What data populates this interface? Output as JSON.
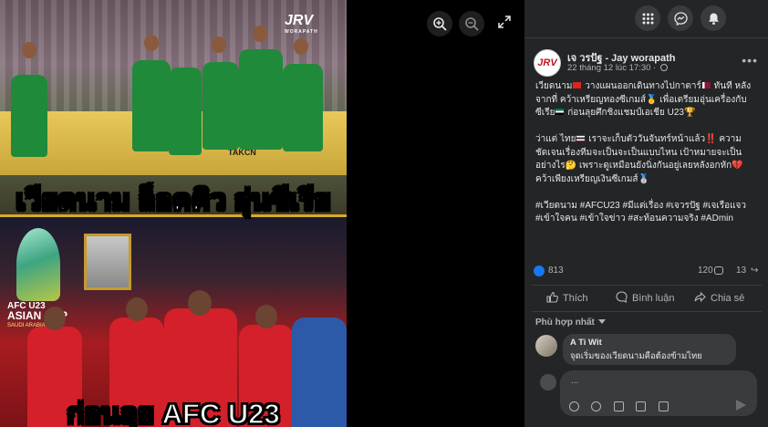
{
  "viewer": {
    "zoom_in_icon": "zoom-in-icon",
    "zoom_out_icon": "zoom-out-icon",
    "expand_icon": "expand-icon",
    "watermark": "JRV",
    "watermark_sub": "WORAPATH",
    "caption_top": "เวียดนาม ล็อคคิว อุ่นซีเรีย",
    "caption_bottom": "ก่อนลุย AFC U23",
    "cup_line1": "AFC U23",
    "cup_line2": "ASIAN CUP",
    "cup_line3": "SAUDI ARABIA 2026",
    "board_text": "TAKCN"
  },
  "topbar": {
    "menu_icon": "grid-menu-icon",
    "messenger_icon": "messenger-icon",
    "notifications_icon": "bell-icon"
  },
  "post": {
    "avatar_text": "JRV",
    "author": "เจ วรปัฐ - Jay worapath",
    "timestamp": "22 tháng 12 lúc 17:30",
    "more_label": "•••",
    "para1_a": "เวียดนาม",
    "para1_b": " วางแผนออกเดินทางไปกาตาร์",
    "para1_c": " ทันที หลังจากที่ คว้าเหรียญทองซีเกมส์🥇 เพื่อเตรียมอุ่นเครื่องกับ ซีเรีย",
    "para1_d": " ก่อนลุยศึกชิงแชมป์เอเชีย U23🏆",
    "para2_a": "ว่าแต่ ไทย",
    "para2_b": " เราจะเก็บตัววันจันทร์หน้าแล้ว‼️ ความชัดเจนเรื่องทีมจะเป็นจะเป็นแบบไหน เป้าหมายจะเป็นอย่างไร🤔 เพราะดูเหมือนยังนิ่งกันอยู่เลยหลังอกหัก💔คว้าเพียงเหรียญเงินซีเกมส์🥈",
    "para3": "#เวียดนาม #AFCU23 #มีแต่เรื่อง #เจวรปัฐ #เจเรือแจว #เข้าใจคน #เข้าใจข่าว #สะท้อนความจริง #ADmin",
    "reaction_count": "813",
    "comment_count": "120",
    "share_count": "13"
  },
  "actions": {
    "like_label": "Thích",
    "comment_label": "Bình luận",
    "share_label": "Chia sẻ"
  },
  "comments": {
    "sort_label": "Phù hợp nhất",
    "items": [
      {
        "name": "A Ti Wit",
        "text": "จุดเริ่มของเวียดนามคือต้องข้ามไทย"
      }
    ]
  },
  "composer": {
    "placeholder": "..."
  },
  "colors": {
    "panel_bg": "#242526",
    "accent_blue": "#1877f2",
    "text_primary": "#e4e6eb",
    "text_secondary": "#b0b3b8"
  }
}
